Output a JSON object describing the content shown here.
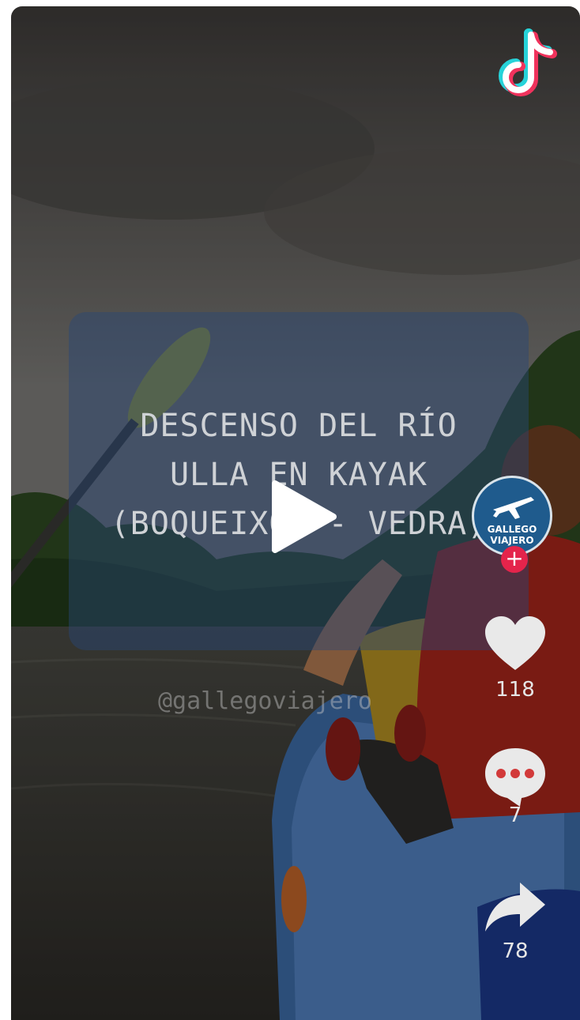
{
  "video": {
    "title_lines": [
      "DESCENSO DEL RÍO",
      "ULLA EN KAYAK",
      "(BOQUEIXÓN - VEDRA)"
    ],
    "author_handle": "@gallegoviajero"
  },
  "channel": {
    "avatar_lines": [
      "GALLEGO",
      "VIAJERO"
    ]
  },
  "actions": {
    "like_count": "118",
    "comment_count": "7",
    "share_count": "78"
  },
  "colors": {
    "follow_badge": "#e4244b",
    "avatar_bg": "#1f5b8d"
  },
  "icons": [
    "tiktok-logo-icon",
    "play-icon",
    "heart-icon",
    "comment-icon",
    "share-icon",
    "plane-icon",
    "plus-icon"
  ]
}
